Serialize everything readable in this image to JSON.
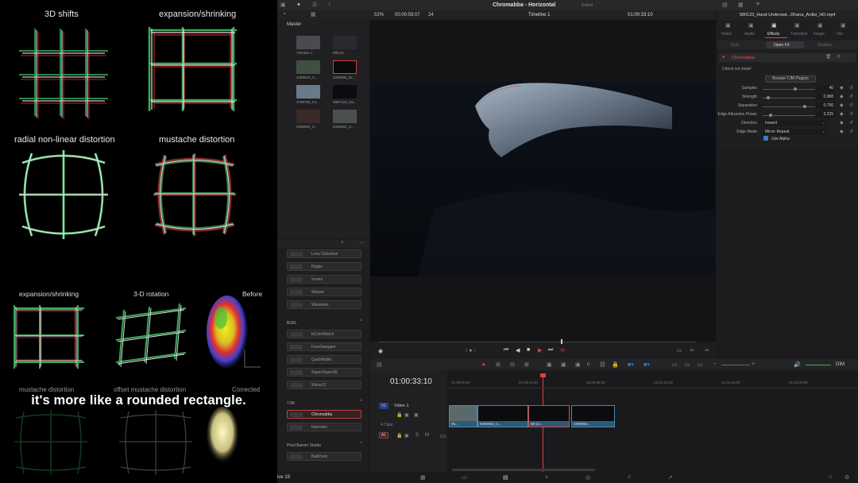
{
  "left": {
    "captions_top": [
      "3D shifts",
      "expansion/shrinking",
      "radial non-linear distortion",
      "mustache distortion"
    ],
    "captions_mid": [
      "expansion/shrinking",
      "3-D rotation",
      "Before"
    ],
    "captions_bottom": [
      "mustache distortion",
      "offset mustache distortion",
      "Corrected"
    ],
    "subtitle": "it's more like a rounded rectangle."
  },
  "topbar": {
    "project": "Chromabba - Horizontal",
    "status": "Edited",
    "zoom": "52%",
    "src_timecode": "00:00:59:07",
    "fps": "24",
    "timeline_name": "Timeline 1",
    "timecode": "01:00:33:10",
    "clip_name": "580123_Hand Underwat...Dhana_Ardisi_HD.mp4"
  },
  "media_pool": {
    "title": "Master",
    "items": [
      {
        "name": "Timeline 1",
        "color": "#4a4a50"
      },
      {
        "name": "Effects",
        "color": "#2a2a2e"
      },
      {
        "name": "4299010_C...",
        "color": "#405040"
      },
      {
        "name": "4299986_Dr...",
        "color": "#0a0a0a"
      },
      {
        "name": "4798765_Fe...",
        "color": "#6a7a8a"
      },
      {
        "name": "5867123_Ha...",
        "color": "#0c0c10"
      },
      {
        "name": "5385862_d...",
        "color": "#3a2a2a"
      },
      {
        "name": "5385862_D...",
        "color": "#4a5050"
      }
    ]
  },
  "effects_list": {
    "group1": [
      "Lens Distortion",
      "Ripple",
      "Vortex",
      "Warper",
      "Waviness"
    ],
    "group2_title": "BSKL",
    "group2": [
      "bColorMatch",
      "FaceSwapper",
      "QuickMatte",
      "SuperSuperXE",
      "Wave12"
    ],
    "group3_title": "TJM",
    "group3": [
      "Chromabba",
      "Interview"
    ],
    "group4_title": "Pixel Barrier Studio",
    "group4": [
      "BallPoint"
    ]
  },
  "inspector": {
    "tabs": [
      "Video",
      "Audio",
      "Effects",
      "Transition",
      "Image",
      "File"
    ],
    "active_tab": "Effects",
    "subtabs": [
      "Tools",
      "Open FX",
      "Shaders"
    ],
    "effect_name": "Chromabba",
    "checkout": "Check out more!",
    "browse_button": "Browse TJM Plugins",
    "params": [
      {
        "label": "Samples",
        "value": "40",
        "level": 0.62
      },
      {
        "label": "Strength",
        "value": "0.388",
        "level": 0.1
      },
      {
        "label": "Separation",
        "value": "0.796",
        "level": 0.8
      },
      {
        "label": "Edge Attraction Power",
        "value": "3.225",
        "level": 0.15
      }
    ],
    "dropdowns": [
      {
        "label": "Direction",
        "value": "Inward"
      },
      {
        "label": "Edge Mode",
        "value": "Mirror Repeat"
      }
    ],
    "checkbox_label": "Use Alpha",
    "checkbox_checked": true
  },
  "timeline": {
    "timecode": "01:00:33:10",
    "ruler": [
      "01:00:00:00",
      "01:00:24:00",
      "01:00:48:00",
      "01:01:12:00",
      "01:01:36:00",
      "01:02:00:00"
    ],
    "video_track": {
      "id": "V1",
      "name": "Video 1",
      "count": "4 Clips"
    },
    "audio_track": {
      "id": "A1",
      "level": "2.0"
    },
    "clips": [
      "05...",
      "5385862_C...",
      "58-12...",
      "4299853..."
    ],
    "volume_label": "DIM"
  },
  "bottom": {
    "app_name": "ive 19"
  }
}
